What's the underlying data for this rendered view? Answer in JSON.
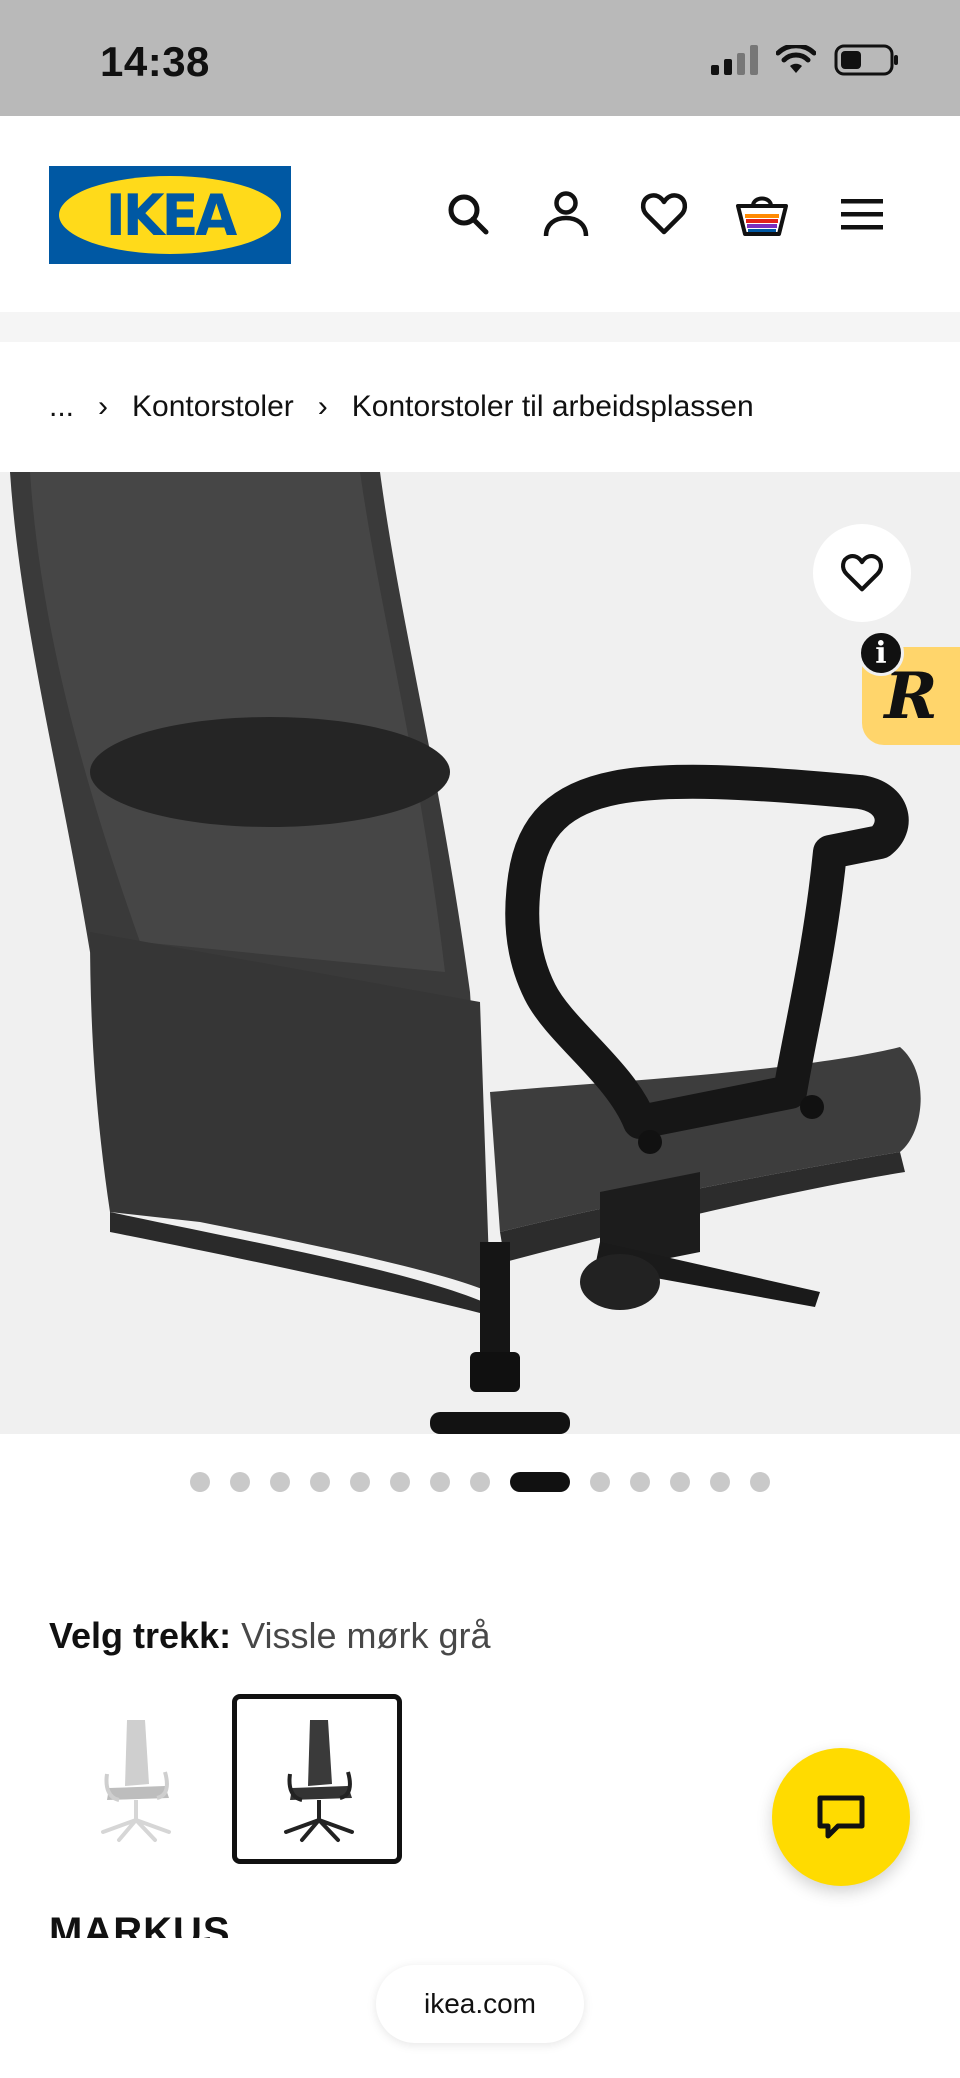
{
  "status_bar": {
    "time": "14:38"
  },
  "header": {
    "logo_text": "IKEA",
    "nav_icons": [
      "search-icon",
      "profile-icon",
      "favourites-icon",
      "shopping-bag-icon",
      "menu-icon"
    ]
  },
  "breadcrumb": {
    "ellipsis": "...",
    "items": [
      "Kontorstoler",
      "Kontorstoler til arbeidsplassen"
    ]
  },
  "gallery": {
    "image_count": 14,
    "active_index": 8,
    "badge_info": "i",
    "badge_r": "R"
  },
  "cover": {
    "label": "Velg trekk:",
    "value": "Vissle mørk grå",
    "options": [
      "light-grey",
      "dark-grey"
    ],
    "selected_index": 1
  },
  "product": {
    "name": "MARKUS"
  },
  "browser": {
    "url": "ikea.com"
  },
  "colors": {
    "ikea_blue": "#0058a3",
    "ikea_yellow": "#ffda1a",
    "chat_yellow": "#ffdb00",
    "status_bar_grey": "#b9b9b9",
    "badge_yellow": "#ffd56b"
  }
}
